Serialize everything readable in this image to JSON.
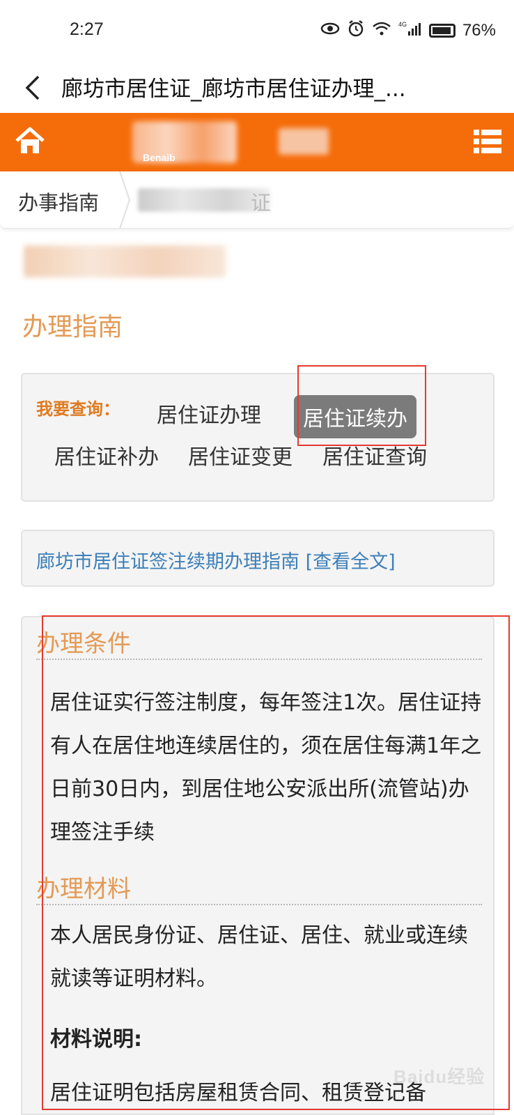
{
  "status_bar": {
    "time": "2:27",
    "battery": "76%",
    "network": "4G"
  },
  "title_bar": {
    "back": "<",
    "title": "廊坊市居住证_廊坊市居住证办理_..."
  },
  "header": {
    "logo_text": "Benaib",
    "accent": "#f56d0a"
  },
  "breadcrumb": {
    "home": "办事指南",
    "tail": "证"
  },
  "section_title": "办理指南",
  "query": {
    "label": "我要查询：",
    "links": [
      "居住证办理",
      "居住证续办",
      "居住证补办",
      "居住证变更",
      "居住证查询"
    ],
    "active_index": 1
  },
  "guide_link": "廊坊市居住证签注续期办理指南 [查看全文]",
  "conditions": {
    "title": "办理条件",
    "text": "居住证实行签注制度，每年签注1次。居住证持有人在居住地连续居住的，须在居住每满1年之日前30日内，到居住地公安派出所(流管站)办理签注手续"
  },
  "materials": {
    "title": "办理材料",
    "text": "本人居民身份证、居住证、居住、就业或连续就读等证明材料。",
    "note_label": "材料说明:",
    "note_text": "居住证明包括房屋租赁合同、租赁登记备"
  },
  "watermark": "Baidu经验",
  "colors": {
    "orange": "#f56d0a",
    "title_orange": "#e39a55",
    "link_blue": "#3d7fb8",
    "highlight_red": "#e5392f"
  }
}
